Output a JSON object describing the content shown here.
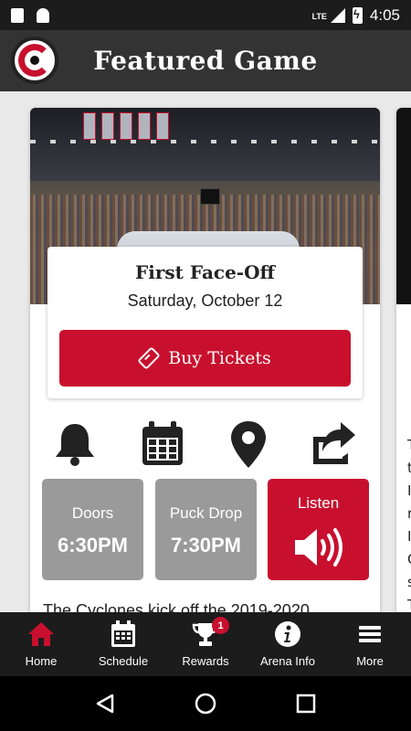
{
  "status_bar": {
    "network": "LTE",
    "time": "4:05"
  },
  "header": {
    "title": "Featured Game"
  },
  "game": {
    "title": "First Face-Off",
    "date": "Saturday, October 12",
    "buy_label": "Buy Tickets"
  },
  "actions": [
    {
      "icon": "bell-icon"
    },
    {
      "icon": "calendar-icon"
    },
    {
      "icon": "location-pin-icon"
    },
    {
      "icon": "share-icon"
    }
  ],
  "tiles": {
    "doors_label": "Doors",
    "doors_time": "6:30PM",
    "puck_label": "Puck Drop",
    "puck_time": "7:30PM",
    "listen_label": "Listen"
  },
  "description": "The Cyclones kick off the 2019-2020",
  "peek_letters": [
    "T",
    "t",
    "I",
    "r",
    "I",
    "C",
    "s",
    "T"
  ],
  "nav": [
    {
      "label": "Home",
      "icon": "home-icon",
      "active": true
    },
    {
      "label": "Schedule",
      "icon": "calendar-icon"
    },
    {
      "label": "Rewards",
      "icon": "trophy-icon",
      "badge": "1"
    },
    {
      "label": "Arena Info",
      "icon": "info-icon"
    },
    {
      "label": "More",
      "icon": "menu-icon"
    }
  ],
  "colors": {
    "accent": "#c8102e",
    "header": "#333333",
    "nav": "#1c1c1c",
    "tile_gray": "#9a9a9a"
  }
}
